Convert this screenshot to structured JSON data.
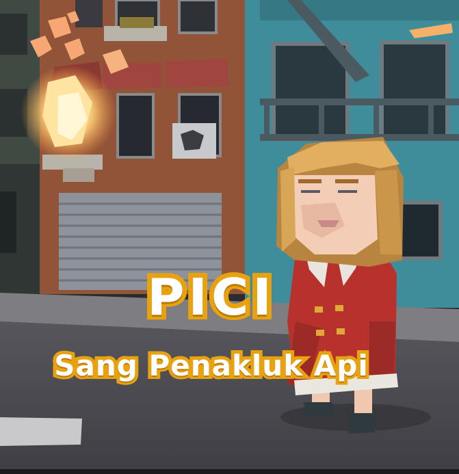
{
  "title": {
    "main": "PICI",
    "subtitle": "Sang Penakluk Api"
  },
  "colors": {
    "title_fill": "#ffffff",
    "title_outline": "#e8a20f",
    "fire": "#ffd27a",
    "building_left": "#9a5a3c",
    "building_right": "#3f8c9b",
    "street": "#4a4a50",
    "character_coat": "#b8322d",
    "character_hair": "#d9a85e"
  },
  "scene": {
    "character": "pici-girl",
    "hazard": "fire"
  }
}
